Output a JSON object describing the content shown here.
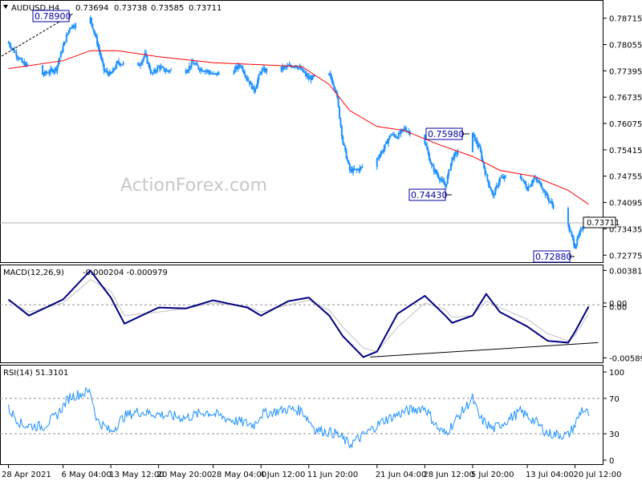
{
  "watermark": "ActionForex.com",
  "colors": {
    "candle": "#1e90ff",
    "sma": "#ff0000",
    "macd_main": "#000080",
    "macd_signal": "#c0c0c0",
    "trendline": "#000000",
    "rsi": "#1e90ff",
    "callout_text": "#0000a0",
    "grid_dash": "#909090"
  },
  "chart_data": [
    {
      "type": "candlestick",
      "panel": "price",
      "header": {
        "symbol": "AUDUSD,H4",
        "open": "0.73694",
        "high": "0.73738",
        "low": "0.73585",
        "close": "0.73711"
      },
      "y_ticks": [
        "0.78715",
        "0.78055",
        "0.77395",
        "0.76735",
        "0.76075",
        "0.75415",
        "0.74755",
        "0.74095",
        "0.73435",
        "0.72775"
      ],
      "current_price_label": "0.73711",
      "current_price": 0.73711,
      "ylim": [
        0.7262,
        0.7905
      ],
      "callouts": [
        {
          "label": "0.78900",
          "date": "2021-05-10",
          "value": 0.789
        },
        {
          "label": "0.75980",
          "date": "2021-07-02",
          "value": 0.7598
        },
        {
          "label": "0.74430",
          "date": "2021-06-29",
          "value": 0.7443
        },
        {
          "label": "0.72880",
          "date": "2021-07-20",
          "value": 0.7288
        }
      ],
      "x_tick_labels": [
        "28 Apr 2021",
        "6 May 04:00",
        "13 May 12:00",
        "20 May 20:00",
        "28 May 04:00",
        "4 Jun 12:00",
        "11 Jun 20:00",
        "21 Jun 04:00",
        "28 Jun 12:00",
        "5 Jul 20:00",
        "13 Jul 04:00",
        "20 Jul 12:00"
      ],
      "x_tick_dates": [
        "2021-04-28",
        "2021-05-06",
        "2021-05-13",
        "2021-05-20",
        "2021-05-28",
        "2021-06-04",
        "2021-06-11",
        "2021-06-21",
        "2021-06-28",
        "2021-07-05",
        "2021-07-13",
        "2021-07-20"
      ],
      "close_path_dates": [
        "2021-04-28",
        "2021-04-30",
        "2021-05-03",
        "2021-05-05",
        "2021-05-06",
        "2021-05-07",
        "2021-05-10",
        "2021-05-11",
        "2021-05-12",
        "2021-05-13",
        "2021-05-14",
        "2021-05-17",
        "2021-05-18",
        "2021-05-19",
        "2021-05-20",
        "2021-05-21",
        "2021-05-24",
        "2021-05-25",
        "2021-05-26",
        "2021-05-27",
        "2021-05-28",
        "2021-05-31",
        "2021-06-01",
        "2021-06-02",
        "2021-06-03",
        "2021-06-04",
        "2021-06-07",
        "2021-06-08",
        "2021-06-09",
        "2021-06-10",
        "2021-06-11",
        "2021-06-14",
        "2021-06-15",
        "2021-06-16",
        "2021-06-17",
        "2021-06-18",
        "2021-06-21",
        "2021-06-22",
        "2021-06-23",
        "2021-06-24",
        "2021-06-25",
        "2021-06-28",
        "2021-06-29",
        "2021-06-30",
        "2021-07-01",
        "2021-07-02",
        "2021-07-05",
        "2021-07-06",
        "2021-07-07",
        "2021-07-08",
        "2021-07-09",
        "2021-07-12",
        "2021-07-13",
        "2021-07-14",
        "2021-07-15",
        "2021-07-16",
        "2021-07-19",
        "2021-07-20",
        "2021-07-21",
        "2021-07-22"
      ],
      "close_path_values": [
        0.781,
        0.776,
        0.773,
        0.7745,
        0.78,
        0.785,
        0.787,
        0.781,
        0.774,
        0.773,
        0.776,
        0.775,
        0.778,
        0.773,
        0.775,
        0.774,
        0.774,
        0.776,
        0.7745,
        0.774,
        0.773,
        0.774,
        0.7755,
        0.772,
        0.769,
        0.774,
        0.7745,
        0.775,
        0.7755,
        0.774,
        0.772,
        0.773,
        0.769,
        0.756,
        0.749,
        0.749,
        0.752,
        0.7545,
        0.758,
        0.7575,
        0.7595,
        0.756,
        0.75,
        0.7475,
        0.745,
        0.752,
        0.758,
        0.7545,
        0.7475,
        0.7425,
        0.747,
        0.7475,
        0.7445,
        0.747,
        0.7455,
        0.742,
        0.735,
        0.73,
        0.7345,
        0.7371
      ],
      "sma_dates": [
        "2021-04-28",
        "2021-05-06",
        "2021-05-10",
        "2021-05-14",
        "2021-05-20",
        "2021-05-28",
        "2021-06-04",
        "2021-06-10",
        "2021-06-14",
        "2021-06-17",
        "2021-06-21",
        "2021-06-25",
        "2021-06-30",
        "2021-07-05",
        "2021-07-09",
        "2021-07-14",
        "2021-07-19",
        "2021-07-22"
      ],
      "sma_values": [
        0.7745,
        0.7765,
        0.779,
        0.779,
        0.7775,
        0.776,
        0.7755,
        0.775,
        0.7705,
        0.764,
        0.76,
        0.759,
        0.7555,
        0.7525,
        0.749,
        0.7475,
        0.744,
        0.7405
      ]
    },
    {
      "type": "line",
      "panel": "macd",
      "title": "MACD(12,26,9)",
      "values_text": "-0.000204 -0.000979",
      "y_ticks": [
        "0.003814",
        "0.00",
        "0.00",
        "-0.005895"
      ],
      "ylim": [
        -0.0063,
        0.0042
      ],
      "series_dates": [
        "2021-04-28",
        "2021-05-01",
        "2021-05-06",
        "2021-05-10",
        "2021-05-13",
        "2021-05-15",
        "2021-05-20",
        "2021-05-24",
        "2021-05-28",
        "2021-06-02",
        "2021-06-04",
        "2021-06-08",
        "2021-06-11",
        "2021-06-14",
        "2021-06-16",
        "2021-06-19",
        "2021-06-21",
        "2021-06-24",
        "2021-06-28",
        "2021-07-01",
        "2021-07-02",
        "2021-07-05",
        "2021-07-07",
        "2021-07-09",
        "2021-07-13",
        "2021-07-16",
        "2021-07-19",
        "2021-07-20",
        "2021-07-22"
      ],
      "macd_values": [
        0.0006,
        -0.0012,
        0.0006,
        0.0038,
        0.0008,
        -0.0021,
        -0.0003,
        -0.0004,
        0.0005,
        -0.0003,
        -0.0012,
        0.0004,
        0.0008,
        -0.0012,
        -0.0035,
        -0.0058,
        -0.0052,
        -0.001,
        0.001,
        -0.0012,
        -0.002,
        -0.0012,
        0.0012,
        -0.0008,
        -0.0024,
        -0.004,
        -0.0042,
        -0.003,
        -0.0002
      ],
      "signal_values": [
        0.0004,
        -0.0008,
        0.0002,
        0.0028,
        0.0015,
        -0.0012,
        -0.0008,
        -0.0004,
        0.0002,
        -0.0002,
        -0.0008,
        0.0,
        0.0005,
        -0.0006,
        -0.0025,
        -0.0048,
        -0.0052,
        -0.0025,
        0.0002,
        -0.0005,
        -0.0014,
        -0.0012,
        0.0004,
        -0.0003,
        -0.0016,
        -0.0032,
        -0.004,
        -0.0034,
        -0.001
      ],
      "trendline": [
        {
          "date": "2021-06-20",
          "value": -0.0058
        },
        {
          "date": "2021-07-22",
          "value": -0.0042
        }
      ]
    },
    {
      "type": "line",
      "panel": "rsi",
      "title": "RSI(14) 51.3101",
      "y_ticks": [
        "100",
        "70",
        "30",
        "0"
      ],
      "levels": [
        70,
        30
      ],
      "ylim": [
        0,
        100
      ],
      "series_dates": [
        "2021-04-28",
        "2021-04-30",
        "2021-05-03",
        "2021-05-05",
        "2021-05-07",
        "2021-05-10",
        "2021-05-11",
        "2021-05-13",
        "2021-05-15",
        "2021-05-17",
        "2021-05-20",
        "2021-05-24",
        "2021-05-27",
        "2021-05-31",
        "2021-06-03",
        "2021-06-04",
        "2021-06-08",
        "2021-06-10",
        "2021-06-12",
        "2021-06-15",
        "2021-06-17",
        "2021-06-19",
        "2021-06-22",
        "2021-06-25",
        "2021-06-28",
        "2021-06-30",
        "2021-07-01",
        "2021-07-02",
        "2021-07-05",
        "2021-07-06",
        "2021-07-08",
        "2021-07-09",
        "2021-07-12",
        "2021-07-14",
        "2021-07-16",
        "2021-07-19",
        "2021-07-20",
        "2021-07-21",
        "2021-07-22"
      ],
      "rsi_values": [
        58,
        40,
        38,
        50,
        72,
        78,
        45,
        32,
        50,
        55,
        52,
        48,
        55,
        45,
        40,
        52,
        58,
        56,
        35,
        30,
        18,
        28,
        45,
        55,
        60,
        35,
        30,
        40,
        70,
        48,
        35,
        40,
        55,
        45,
        30,
        28,
        40,
        58,
        52
      ]
    }
  ]
}
